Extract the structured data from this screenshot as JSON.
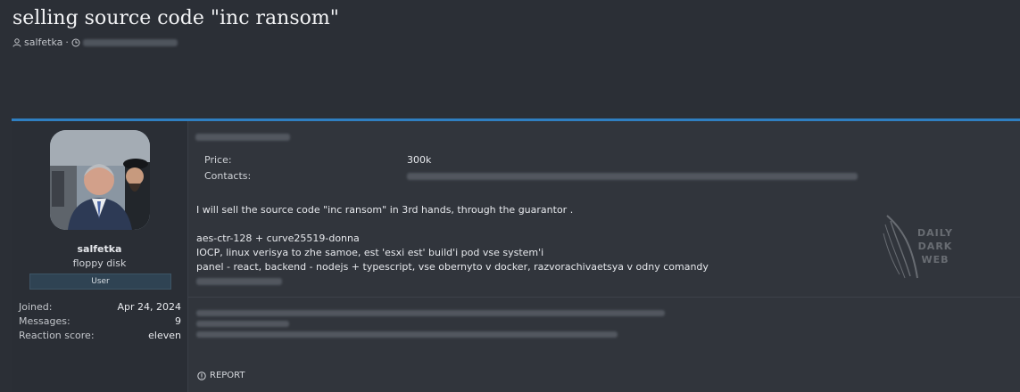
{
  "thread": {
    "title": "selling source code \"inc ransom\"",
    "author": "salfetka",
    "separator": "·"
  },
  "user": {
    "name": "salfetka",
    "title": "floppy disk",
    "banner": "User",
    "stats": [
      {
        "label": "Joined:",
        "value": "Apr 24, 2024"
      },
      {
        "label": "Messages:",
        "value": "9"
      },
      {
        "label": "Reaction score:",
        "value": "eleven"
      }
    ]
  },
  "post": {
    "fields": [
      {
        "label": "Price:",
        "value": "300k"
      },
      {
        "label": "Contacts:",
        "value": ""
      }
    ],
    "lines": [
      "I will sell the source code \"inc ransom\" in 3rd hands, through the guarantor .",
      "",
      "aes-ctr-128 + curve25519-donna",
      "IOCP, linux verisya to zhe samoe, est 'esxi est' build'i pod vse system'i",
      "panel - react, backend - nodejs + typescript, vse obernyto v docker, razvorachivaetsya v odny comandy"
    ],
    "report_label": "REPORT"
  },
  "watermark": {
    "line1": "DAILY",
    "line2": "DARK",
    "line3": "WEB"
  },
  "icons": [
    "user-icon",
    "clock-icon",
    "report-icon"
  ]
}
